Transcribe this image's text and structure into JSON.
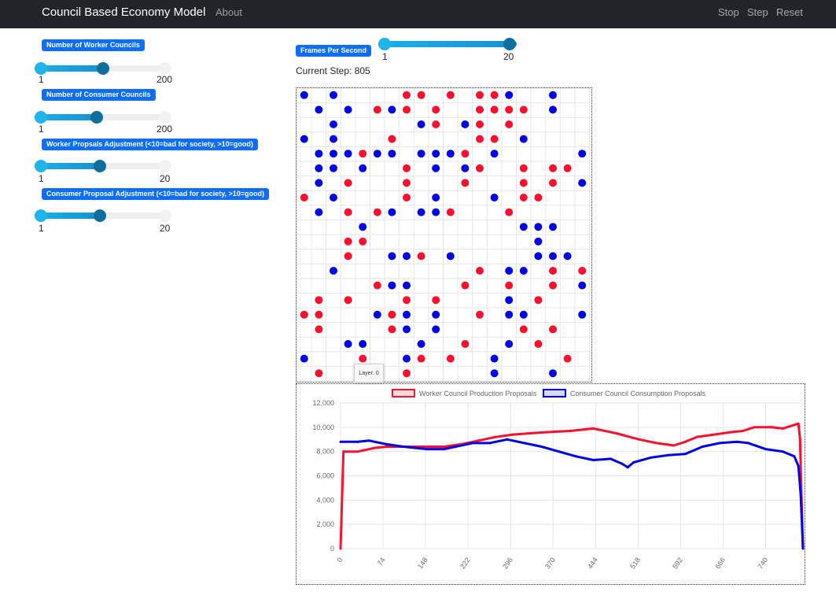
{
  "navbar": {
    "brand": "Council Based Economy Model",
    "about": "About",
    "stop": "Stop",
    "step": "Step",
    "reset": "Reset"
  },
  "controls": {
    "worker_councils": {
      "label": "Number of Worker Councils",
      "min": "1",
      "max": "200",
      "value": 70
    },
    "consumer_councils": {
      "label": "Number of Consumer Councils",
      "min": "1",
      "max": "200",
      "value": 63
    },
    "worker_adjust": {
      "label": "Worker Propsals Adjustment (<10=bad for society, >10=good)",
      "min": "1",
      "max": "20",
      "value": 10
    },
    "consumer_adjust": {
      "label": "Consumer Proposal Adjustment (<10=bad for society, >10=good)",
      "min": "1",
      "max": "20",
      "value": 10
    },
    "fps": {
      "label": "Frames Per Second",
      "min": "1",
      "max": "20",
      "value": 20
    }
  },
  "simulation": {
    "step_label": "Current Step: 805",
    "tooltip": "Layer: 0"
  },
  "colors": {
    "worker": "#ff0f2e",
    "consumer": "#0000e6",
    "navbar": "#212529",
    "badge": "#0d6efd"
  },
  "grid": {
    "rows": 20,
    "cols": 20,
    "cells": [
      "B.B....RR.R.RRB..B..",
      ".B.B.RBR.R..RRRR.B..",
      "..B.....BR.BR.R.....",
      "B.B...R.....RR.B....",
      ".BBBRBB.BBBR.B.....B",
      ".BB.B..R.B.BR..R.RR.",
      ".B.R...R...R...R.R.B",
      "R.B....R.B...B.RR...",
      ".B.R.RB.BBR...R.....",
      "....B..........BBB..",
      "...RR...........B...",
      "...R..BBR.B.....BBB.",
      "..B.........R.BB.R.R",
      ".....RBB...R..R..R.B",
      ".R.R...R.R....B.R...",
      "RR...BRB.B..R.BB...B",
      ".R....RB.B.....R.R..",
      "...BB...B..R..B.R...",
      "B...R..BR.R..B....R.",
      ".R.....R.....B...B..",
      ".BR..........B....R."
    ]
  },
  "chart_data": {
    "type": "line",
    "title": "",
    "xlabel": "",
    "ylabel": "",
    "ylim": [
      0,
      12000
    ],
    "yticks": [
      "0",
      "2,000",
      "4,000",
      "6,000",
      "8,000",
      "10,000",
      "12,000"
    ],
    "xticks": [
      "0",
      "74",
      "148",
      "222",
      "296",
      "370",
      "444",
      "518",
      "592",
      "666",
      "740"
    ],
    "xlim": [
      0,
      805
    ],
    "legend_position": "top",
    "series": [
      {
        "name": "Worker Council Production Proposals",
        "color": "#ff0f2e",
        "points": [
          [
            0,
            0
          ],
          [
            5,
            8000
          ],
          [
            30,
            8000
          ],
          [
            60,
            8300
          ],
          [
            80,
            8400
          ],
          [
            110,
            8400
          ],
          [
            150,
            8400
          ],
          [
            180,
            8400
          ],
          [
            210,
            8600
          ],
          [
            240,
            8900
          ],
          [
            270,
            9200
          ],
          [
            300,
            9400
          ],
          [
            330,
            9500
          ],
          [
            360,
            9600
          ],
          [
            400,
            9700
          ],
          [
            440,
            9900
          ],
          [
            480,
            9500
          ],
          [
            520,
            9000
          ],
          [
            550,
            8700
          ],
          [
            580,
            8500
          ],
          [
            600,
            8800
          ],
          [
            620,
            9200
          ],
          [
            650,
            9400
          ],
          [
            680,
            9600
          ],
          [
            700,
            9700
          ],
          [
            720,
            10000
          ],
          [
            750,
            10000
          ],
          [
            770,
            9900
          ],
          [
            790,
            10200
          ],
          [
            797,
            10300
          ],
          [
            800,
            9000
          ],
          [
            802,
            5000
          ],
          [
            805,
            0
          ]
        ]
      },
      {
        "name": "Consumer Council Consumption Proposals",
        "color": "#0000e6",
        "points": [
          [
            0,
            8800
          ],
          [
            30,
            8800
          ],
          [
            50,
            8900
          ],
          [
            80,
            8600
          ],
          [
            110,
            8400
          ],
          [
            150,
            8200
          ],
          [
            180,
            8200
          ],
          [
            200,
            8400
          ],
          [
            230,
            8700
          ],
          [
            260,
            8700
          ],
          [
            290,
            9000
          ],
          [
            320,
            8700
          ],
          [
            350,
            8400
          ],
          [
            380,
            8000
          ],
          [
            410,
            7600
          ],
          [
            440,
            7300
          ],
          [
            470,
            7400
          ],
          [
            490,
            7000
          ],
          [
            500,
            6700
          ],
          [
            510,
            7100
          ],
          [
            540,
            7500
          ],
          [
            570,
            7700
          ],
          [
            600,
            7800
          ],
          [
            630,
            8400
          ],
          [
            660,
            8700
          ],
          [
            690,
            8800
          ],
          [
            710,
            8700
          ],
          [
            740,
            8200
          ],
          [
            770,
            8000
          ],
          [
            790,
            7600
          ],
          [
            797,
            6800
          ],
          [
            801,
            4500
          ],
          [
            805,
            0
          ]
        ]
      }
    ]
  }
}
